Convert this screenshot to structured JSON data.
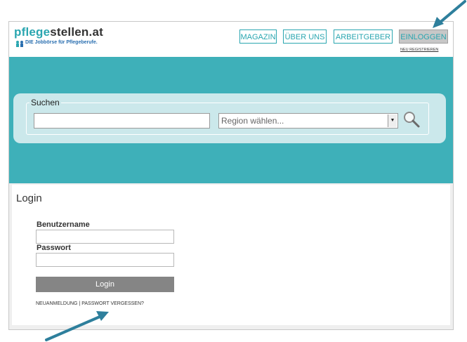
{
  "header": {
    "logo": {
      "prefix": "pflege",
      "suffix": "stellen.at",
      "tagline": "DIE Jobbörse für Pflegeberufe."
    },
    "nav": [
      "MAGAZIN",
      "ÜBER UNS",
      "ARBEITGEBER",
      "EINLOGGEN"
    ],
    "register_link": "NEU REGISTRIEREN"
  },
  "search": {
    "legend": "Suchen",
    "keyword_value": "",
    "region_placeholder": "Region wählen..."
  },
  "login": {
    "title": "Login",
    "username_label": "Benutzername",
    "password_label": "Passwort",
    "button_label": "Login",
    "links": "NEUANMELDUNG | PASSWORT VERGESSEN?"
  },
  "colors": {
    "accent": "#2aa6b0",
    "hero": "#3eb0b9",
    "annotation_arrow": "#2e7f9c"
  }
}
